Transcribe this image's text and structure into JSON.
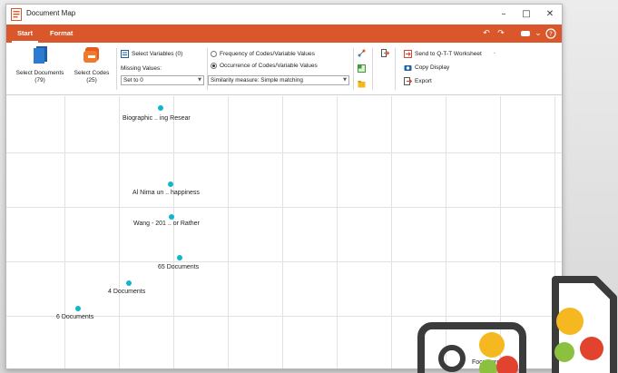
{
  "window": {
    "title": "Document Map"
  },
  "window_controls": {
    "minimize": "–",
    "maximize": "□",
    "close": "✕"
  },
  "tabs": [
    {
      "label": "Start",
      "active": true
    },
    {
      "label": "Format",
      "active": false
    }
  ],
  "ribbon": {
    "select_documents": {
      "label": "Select Documents",
      "count": "(79)"
    },
    "select_codes": {
      "label": "Select Codes",
      "count": "(25)"
    },
    "select_variables": "Select Variables (0)",
    "missing_values_label": "Missing Values:",
    "missing_values_value": "Set to 0",
    "radio_frequency": "Frequency of Codes/Variable Values",
    "radio_occurrence": "Occurrence of Codes/Variable Values",
    "similarity_value": "Similarity measure: Simple matching",
    "send_qtt": "Send to Q-T-T Worksheet",
    "copy_display": "Copy Display",
    "export": "Export"
  },
  "plot": {
    "points": [
      {
        "label": "Biographic .. ing Resear"
      },
      {
        "label": "Al Nima un .. happiness"
      },
      {
        "label": "Wang - 201 .. or Rather"
      },
      {
        "label": "65 Documents"
      },
      {
        "label": "4 Documents"
      },
      {
        "label": "6 Documents"
      },
      {
        "label": "Focus group"
      }
    ]
  },
  "colors": {
    "accent": "#d9572a",
    "point": "#11b5d0",
    "deco_yellow": "#f5b820",
    "deco_red": "#e2432f",
    "deco_green": "#8cc13f"
  }
}
